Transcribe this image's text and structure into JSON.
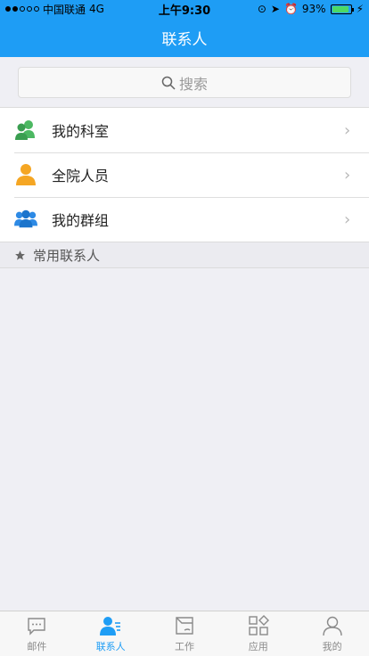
{
  "status_bar": {
    "carrier": "中国联通",
    "network": "4G",
    "time": "上午9:30",
    "battery": "93%",
    "battery_level": 0.93
  },
  "nav": {
    "title": "联系人"
  },
  "search": {
    "placeholder": "搜索"
  },
  "list": {
    "items": [
      {
        "label": "我的科室",
        "icon": "department-icon",
        "color": "#4cb862"
      },
      {
        "label": "全院人员",
        "icon": "person-icon",
        "color": "#f5a623"
      },
      {
        "label": "我的群组",
        "icon": "group-icon",
        "color": "#2d8ae5"
      }
    ]
  },
  "section": {
    "label": "常用联系人",
    "icon": "star-icon"
  },
  "tabs": [
    {
      "label": "邮件",
      "icon": "mail-icon",
      "active": false
    },
    {
      "label": "联系人",
      "icon": "contacts-icon",
      "active": true
    },
    {
      "label": "工作",
      "icon": "folder-icon",
      "active": false
    },
    {
      "label": "应用",
      "icon": "apps-icon",
      "active": false
    },
    {
      "label": "我的",
      "icon": "profile-icon",
      "active": false
    }
  ],
  "colors": {
    "primary": "#1e9df5",
    "background": "#efeff4"
  }
}
